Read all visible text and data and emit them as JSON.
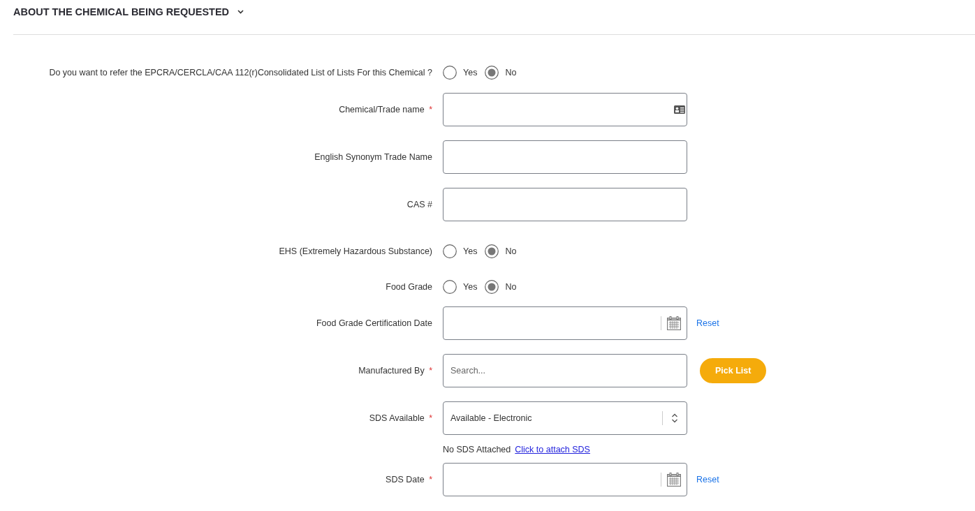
{
  "section": {
    "title": "ABOUT THE CHEMICAL BEING REQUESTED",
    "expanded": true
  },
  "rows": [
    {
      "kind": "radio",
      "label": "Do you want to refer the EPCRA/CERCLA/CAA 112(r)Consolidated List of Lists For this Chemical ?",
      "options": [
        {
          "label": "Yes",
          "selected": false
        },
        {
          "label": "No",
          "selected": true
        }
      ]
    },
    {
      "kind": "lookup",
      "label": "Chemical/Trade name",
      "required_mark": "*"
    },
    {
      "kind": "text",
      "label": "English Synonym Trade Name"
    },
    {
      "kind": "text",
      "label": "CAS #"
    },
    {
      "kind": "radio",
      "label": "EHS (Extremely Hazardous Substance)",
      "options": [
        {
          "label": "Yes",
          "selected": false
        },
        {
          "label": "No",
          "selected": true
        }
      ]
    },
    {
      "kind": "radio",
      "label": "Food Grade",
      "options": [
        {
          "label": "Yes",
          "selected": false
        },
        {
          "label": "No",
          "selected": true
        }
      ]
    },
    {
      "kind": "date",
      "label": "Food Grade Certification Date",
      "reset": "Reset"
    },
    {
      "kind": "search",
      "label": "Manufactured By",
      "required_mark": "*",
      "placeholder": "Search...",
      "button": "Pick List"
    },
    {
      "kind": "select",
      "label": "SDS Available",
      "required_mark": "*",
      "value": "Available - Electronic"
    },
    {
      "kind": "note",
      "text": "No SDS Attached",
      "link": "Click to attach SDS"
    },
    {
      "kind": "date",
      "label": "SDS Date",
      "required_mark": "*",
      "reset": "Reset"
    }
  ]
}
